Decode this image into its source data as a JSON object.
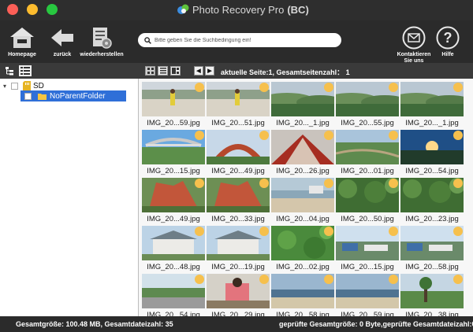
{
  "window": {
    "title": "Photo Recovery Pro",
    "title_suffix": "(BC)",
    "app_icon": "app-logo-icon"
  },
  "toolbar": {
    "homepage": "Homepage",
    "back": "zurück",
    "restore": "wiederherstellen",
    "contact": "Kontaktieren Sie uns",
    "help": "Hilfe"
  },
  "search": {
    "placeholder": "Bitte geben Sie die Suchbedingung ein!"
  },
  "tree": {
    "root": "SD",
    "child": "NoParentFolder"
  },
  "viewbar": {
    "page_info": "aktuelle Seite:1,  Gesamtseitenzahl： 1"
  },
  "thumbnails": [
    {
      "name": "IMG_20...59.jpg",
      "scene": "plaza"
    },
    {
      "name": "IMG_20...51.jpg",
      "scene": "plaza"
    },
    {
      "name": "IMG_20..._1.jpg",
      "scene": "hills"
    },
    {
      "name": "IMG_20...55.jpg",
      "scene": "hills"
    },
    {
      "name": "IMG_20..._1.jpg",
      "scene": "hills"
    },
    {
      "name": "IMG_20...15.jpg",
      "scene": "bridge"
    },
    {
      "name": "IMG_20...49.jpg",
      "scene": "arch"
    },
    {
      "name": "IMG_20...26.jpg",
      "scene": "redbridge"
    },
    {
      "name": "IMG_20...01.jpg",
      "scene": "valley"
    },
    {
      "name": "IMG_20...54.jpg",
      "scene": "sunset"
    },
    {
      "name": "IMG_20...49.jpg",
      "scene": "cliff"
    },
    {
      "name": "IMG_20...33.jpg",
      "scene": "cliff"
    },
    {
      "name": "IMG_20...04.jpg",
      "scene": "beach"
    },
    {
      "name": "IMG_20...50.jpg",
      "scene": "forest"
    },
    {
      "name": "IMG_20...23.jpg",
      "scene": "forest"
    },
    {
      "name": "IMG_20...48.jpg",
      "scene": "house"
    },
    {
      "name": "IMG_20...19.jpg",
      "scene": "house"
    },
    {
      "name": "IMG_20...02.jpg",
      "scene": "leaves"
    },
    {
      "name": "IMG_20...15.jpg",
      "scene": "town"
    },
    {
      "name": "IMG_20...58.jpg",
      "scene": "town"
    },
    {
      "name": "IMG_20...54.jpg",
      "scene": "shore"
    },
    {
      "name": "IMG_20...29.jpg",
      "scene": "person"
    },
    {
      "name": "IMG_20...58.jpg",
      "scene": "sea"
    },
    {
      "name": "IMG_20...59.jpg",
      "scene": "sea"
    },
    {
      "name": "IMG_20...38.jpg",
      "scene": "park"
    }
  ],
  "status": {
    "total_size": "Gesamtgröße: 100.48 MB,  Gesamtdateizahl: 35",
    "checked": "geprüfte Gesamtgröße: 0 Byte,geprüfte Gesamtdateizahl:0"
  },
  "colors": {
    "accent_selection": "#2f6fd8",
    "badge": "#f6c04d",
    "chrome": "#2b2b2b"
  }
}
